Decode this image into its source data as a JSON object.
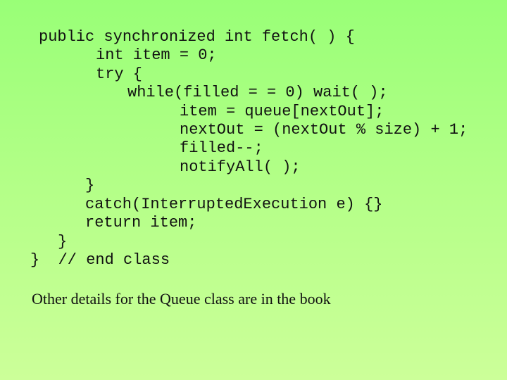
{
  "slide": {
    "code_lines": [
      "public synchronized int fetch( ) {",
      "int item = 0;",
      "try {",
      "while(filled = = 0) wait( );",
      "item = queue[nextOut];",
      "nextOut = (nextOut % size) + 1;",
      "filled--;",
      "notifyAll( );",
      "}",
      "catch(InterruptedExecution e) {}",
      "return item;",
      "}",
      "}  // end class"
    ],
    "note": "Other details for the Queue class are in the book"
  }
}
